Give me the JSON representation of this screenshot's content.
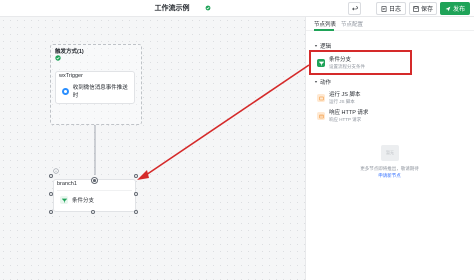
{
  "header": {
    "title": "工作流示例",
    "log_label": "日志",
    "save_label": "保存",
    "publish_label": "发布"
  },
  "canvas": {
    "trigger_group": {
      "title": "触发方式(1)",
      "card_label": "wxTrigger",
      "trigger_text": "收到微信消息事件推送时"
    },
    "branch_node": {
      "card_label": "branch1",
      "branch_text": "条件分支"
    }
  },
  "panel": {
    "tabs": [
      "节点列表",
      "节点配置"
    ],
    "logic_section": "逻辑",
    "action_section": "动作",
    "items": [
      {
        "title": "条件分支",
        "desc": "设置流程分支条件"
      },
      {
        "title": "运行 JS 脚本",
        "desc": "运行 JS 脚本"
      },
      {
        "title": "响应 HTTP 请求",
        "desc": "响应 HTTP 请求"
      }
    ],
    "empty": {
      "image_text": "暂无",
      "text": "更多节点即将推出，敬请期待",
      "link": "申请新节点"
    }
  },
  "colors": {
    "accent": "#1fa358",
    "highlight": "#d52a2a",
    "link": "#3370ff"
  }
}
